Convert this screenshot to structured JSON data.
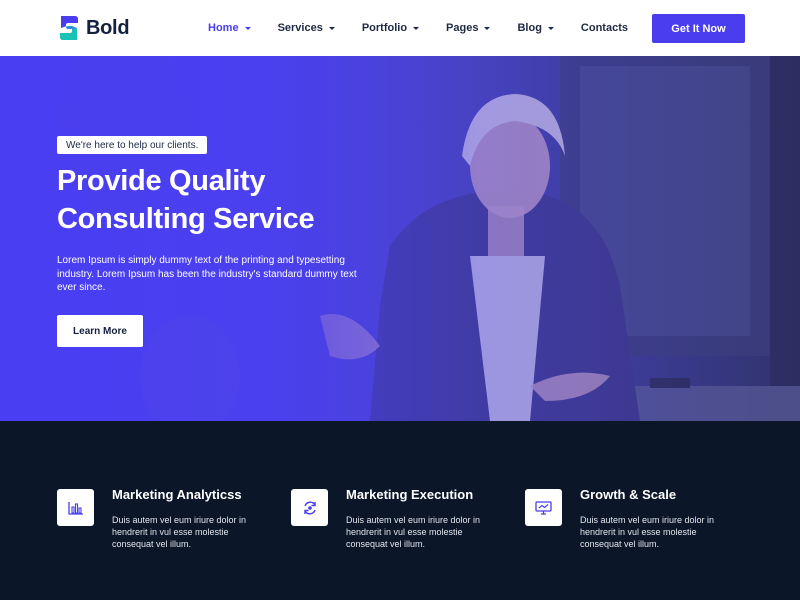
{
  "brand": {
    "name": "Bold",
    "colors": {
      "accent": "#4a3df0",
      "dark": "#0b1628",
      "text": "#1e2a44"
    }
  },
  "nav": {
    "items": [
      {
        "label": "Home",
        "dropdown": true,
        "active": true
      },
      {
        "label": "Services",
        "dropdown": true
      },
      {
        "label": "Portfolio",
        "dropdown": true
      },
      {
        "label": "Pages",
        "dropdown": true
      },
      {
        "label": "Blog",
        "dropdown": true
      },
      {
        "label": "Contacts",
        "dropdown": false
      }
    ],
    "cta_label": "Get It Now"
  },
  "hero": {
    "tag": "We're here to help our clients.",
    "title_line1": "Provide Quality",
    "title_line2": "Consulting Service",
    "description": "Lorem Ipsum is simply dummy text of the printing and typesetting industry. Lorem Ipsum has been the industry's standard dummy text ever since.",
    "button_label": "Learn More"
  },
  "features": [
    {
      "icon": "bar-chart-icon",
      "title": "Marketing Analyticss",
      "description": "Duis autem vel eum iriure dolor in hendrerit in vul esse molestie consequat vel illum."
    },
    {
      "icon": "refresh-cycle-icon",
      "title": "Marketing Execution",
      "description": "Duis autem vel eum iriure dolor in hendrerit in vul esse molestie consequat vel illum."
    },
    {
      "icon": "monitor-chart-icon",
      "title": "Growth & Scale",
      "description": "Duis autem vel eum iriure dolor in hendrerit in vul esse molestie consequat vel illum."
    }
  ]
}
